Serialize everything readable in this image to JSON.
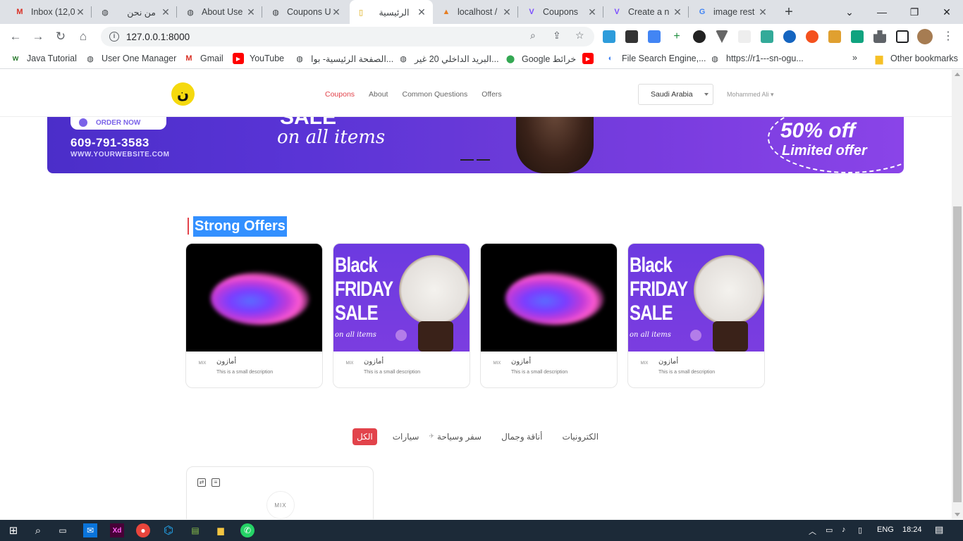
{
  "browser": {
    "tabs": [
      {
        "title": "Inbox (12,0",
        "favicon": "gmail-icon"
      },
      {
        "title": "من نحن",
        "favicon": "globe-icon"
      },
      {
        "title": "About Use",
        "favicon": "globe-icon"
      },
      {
        "title": "Coupons U",
        "favicon": "globe-icon"
      },
      {
        "title": "الرئيسية",
        "favicon": "page-icon"
      },
      {
        "title": "localhost /",
        "favicon": "phpmyadmin-icon"
      },
      {
        "title": "Coupons",
        "favicon": "v-icon"
      },
      {
        "title": "Create a n",
        "favicon": "v-icon"
      },
      {
        "title": "image rest",
        "favicon": "google-icon"
      }
    ],
    "url": "127.0.0.1:8000",
    "bookmarks": [
      "Java Tutorial",
      "User One Manager",
      "Gmail",
      "YouTube",
      "الصفحة الرئيسية- بوا...",
      "البريد الداخلي 20 غير...",
      "Google خرائط",
      "",
      "File Search Engine,...",
      "https://r1---sn-ogu..."
    ],
    "other_bookmarks": "Other bookmarks",
    "bookmarks_more": "»"
  },
  "site": {
    "logo": "ن",
    "nav": [
      "Coupons",
      "About",
      "Common Questions",
      "Offers"
    ],
    "country": "Saudi Arabia",
    "user": "Mohammed Ali"
  },
  "banner": {
    "order_label": "ORDER NOW",
    "phone": "609-791-3583",
    "website": "WWW.YOURWEBSITE.COM",
    "sale_fragment": "SALE",
    "on_all_items": "on all items",
    "percent": "50% off",
    "limited": "Limited offer"
  },
  "strong_offers": {
    "title": "Strong Offers",
    "cards": [
      {
        "image": "nebula",
        "name": "أمازون",
        "desc": "This is a small description",
        "logo": "MIX"
      },
      {
        "image": "black-friday",
        "name": "أمازون",
        "desc": "This is a small description",
        "logo": "MIX",
        "bf_text": "Black\nFRIDAY\nSALE",
        "bf_sub": "on all items"
      },
      {
        "image": "nebula",
        "name": "أمازون",
        "desc": "This is a small description",
        "logo": "MIX"
      },
      {
        "image": "black-friday",
        "name": "أمازون",
        "desc": "This is a small description",
        "logo": "MIX",
        "bf_text": "Black\nFRIDAY\nSALE",
        "bf_sub": "on all items"
      }
    ]
  },
  "filters": {
    "items": [
      "الكل",
      "سيارات",
      "سفر وسياحة",
      "أناقة وجمال",
      "الكترونيات"
    ],
    "active": "الكل"
  },
  "bottom_card": {
    "logo": "MIX"
  },
  "taskbar": {
    "lang": "ENG",
    "time": "18:24"
  }
}
